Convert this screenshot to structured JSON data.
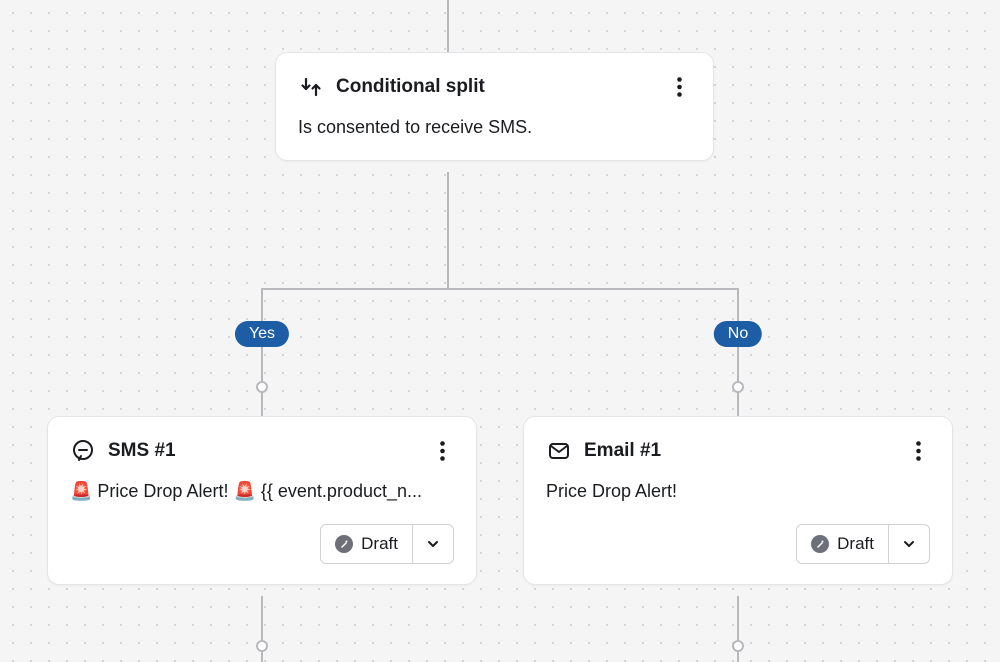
{
  "split": {
    "title": "Conditional split",
    "description": "Is consented to receive SMS."
  },
  "branches": {
    "yes_label": "Yes",
    "no_label": "No"
  },
  "sms_card": {
    "title": "SMS #1",
    "preview": "🚨 Price Drop Alert! 🚨 {{ event.product_n...",
    "status_label": "Draft"
  },
  "email_card": {
    "title": "Email #1",
    "preview": "Price Drop Alert!",
    "status_label": "Draft"
  }
}
